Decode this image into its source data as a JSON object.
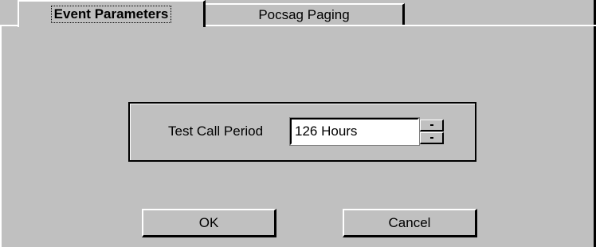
{
  "tabs": [
    {
      "label": "Event Parameters",
      "active": true
    },
    {
      "label": "Pocsag Paging",
      "active": false
    }
  ],
  "test_call": {
    "label": "Test Call Period",
    "value": "126 Hours"
  },
  "buttons": {
    "ok": "OK",
    "cancel": "Cancel"
  },
  "colors": {
    "face": "#c0c0c0",
    "highlight": "#ffffff",
    "shadow": "#000000"
  }
}
